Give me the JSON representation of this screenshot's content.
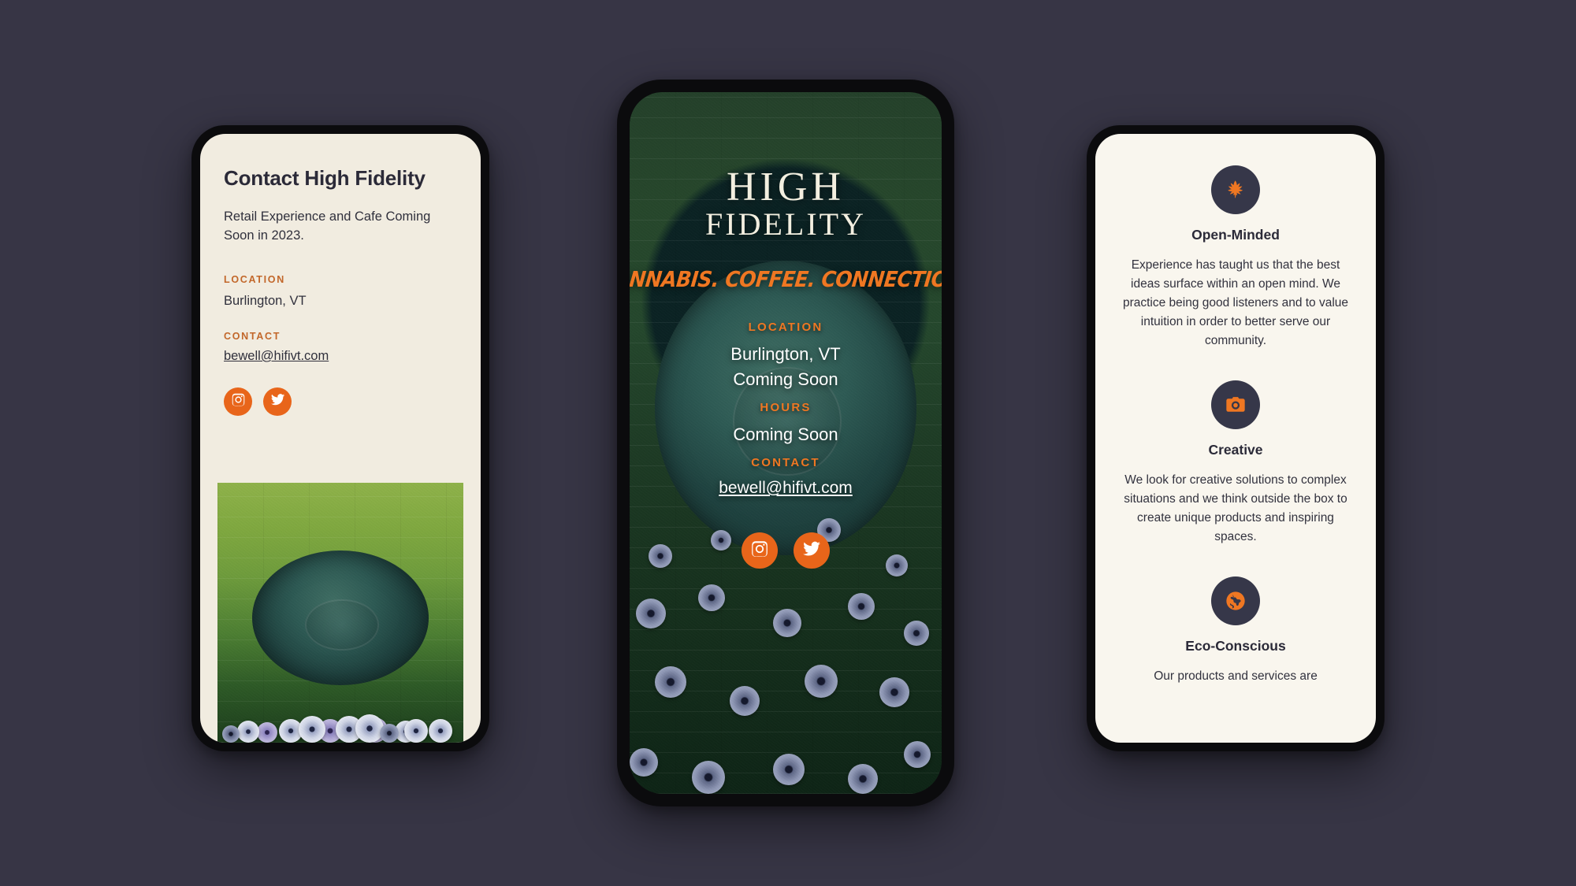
{
  "canvas": {
    "background": "#373545"
  },
  "palette": {
    "accent_orange": "#e8651a",
    "label_orange": "#c2672a",
    "tagline_orange": "#ef7722",
    "cream": "#f1ece0",
    "ink": "#2b2a38",
    "icon_circle": "#363749"
  },
  "left_phone": {
    "name": "contact-screen",
    "heading": "Contact High Fidelity",
    "lead": "Retail Experience and Cafe Coming Soon in 2023.",
    "location_label": "LOCATION",
    "location_value": "Burlington, VT",
    "contact_label": "CONTACT",
    "email": "bewell@hifivt.com",
    "social": [
      {
        "name": "instagram-icon",
        "label": "Instagram"
      },
      {
        "name": "twitter-icon",
        "label": "Twitter"
      }
    ],
    "photo_alt": "Green-tinted photo of a round stone planter surrounded by white and purple petunias"
  },
  "center_phone": {
    "name": "landing-hero-screen",
    "logo_line1": "HIGH",
    "logo_line2": "FIDELITY",
    "tagline": "CANNABIS. COFFEE. CONNECTION.",
    "location_label": "LOCATION",
    "location_value": "Burlington, VT",
    "location_status": "Coming Soon",
    "hours_label": "HOURS",
    "hours_value": "Coming Soon",
    "contact_label": "CONTACT",
    "email": "bewell@hifivt.com",
    "social": [
      {
        "name": "instagram-icon",
        "label": "Instagram"
      },
      {
        "name": "twitter-icon",
        "label": "Twitter"
      }
    ],
    "photo_alt": "Dark green wall with round planter and dusky petunia blooms"
  },
  "right_phone": {
    "name": "values-screen",
    "values": [
      {
        "icon": "cannabis-leaf-icon",
        "title": "Open-Minded",
        "body": "Experience has taught us that the best ideas surface within an open mind. We practice being good listeners and to value intuition in order to better serve our community."
      },
      {
        "icon": "camera-icon",
        "title": "Creative",
        "body": "We look for creative solutions to complex situations and we think outside the box to create unique products and inspiring spaces."
      },
      {
        "icon": "globe-icon",
        "title": "Eco-Conscious",
        "body": "Our products and services are"
      }
    ]
  }
}
